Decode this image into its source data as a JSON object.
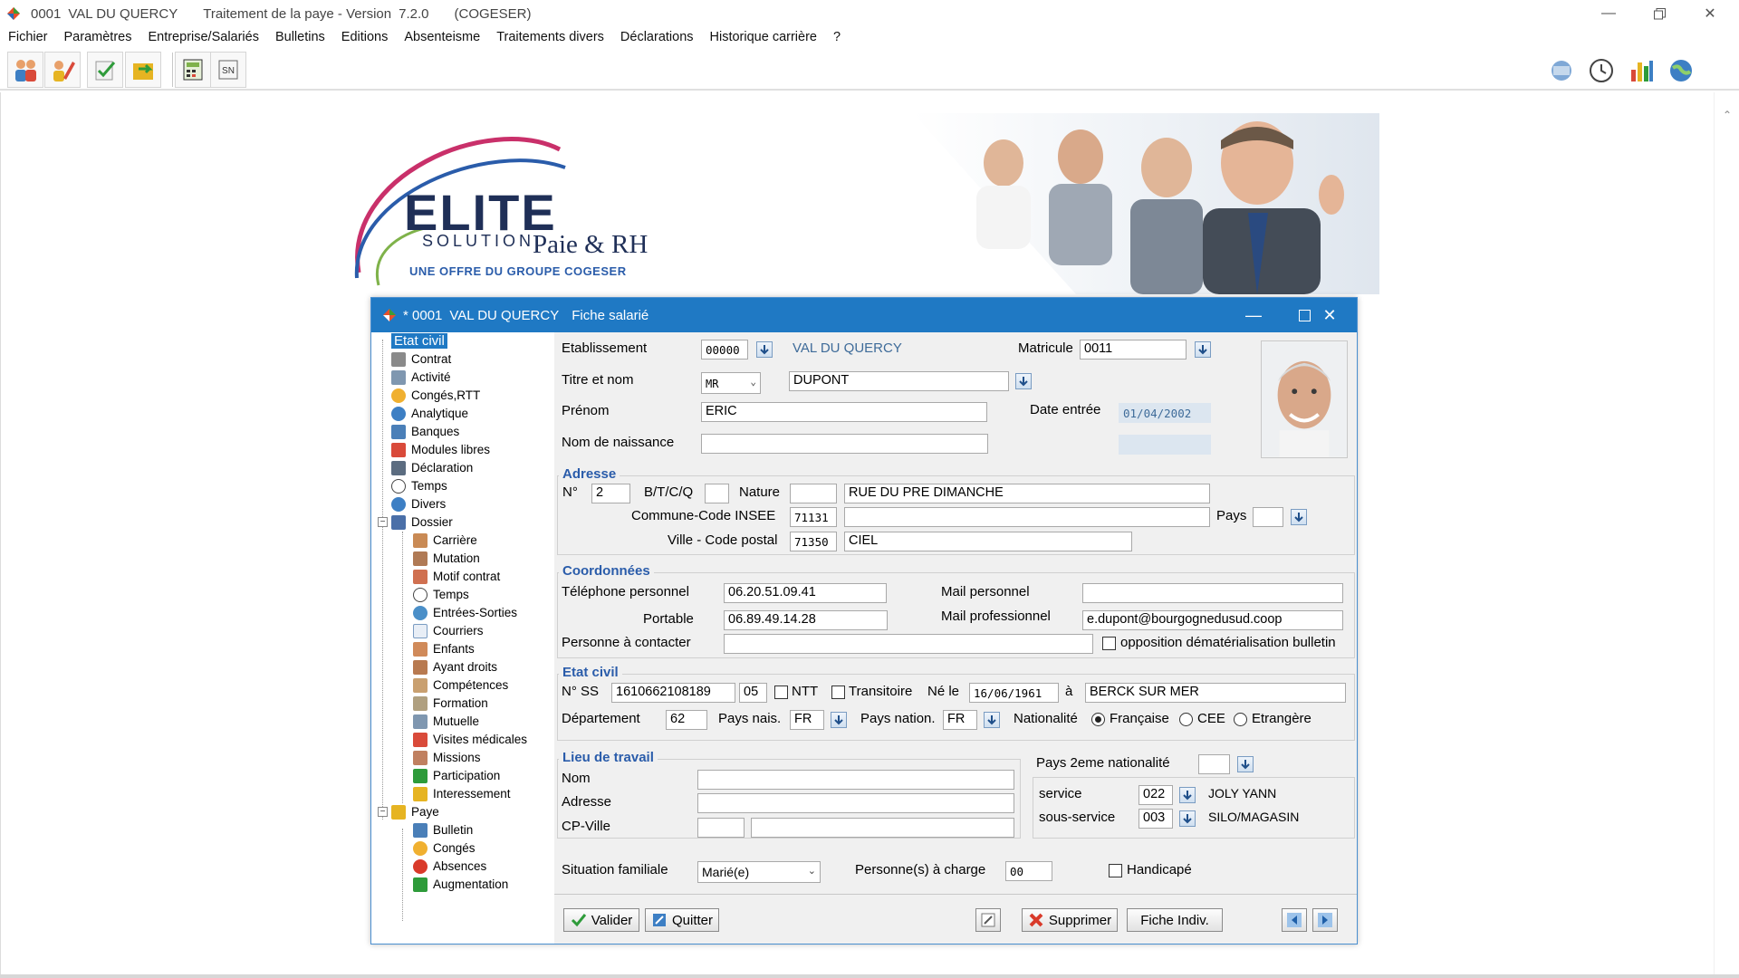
{
  "window": {
    "code": "0001",
    "company": "VAL DU QUERCY",
    "app": "Traitement de la paye - Version",
    "version": "7.2.0",
    "vendor": "(COGESER)"
  },
  "menu": [
    "Fichier",
    "Paramètres",
    "Entreprise/Salariés",
    "Bulletins",
    "Editions",
    "Absenteisme",
    "Traitements divers",
    "Déclarations",
    "Historique carrière",
    "?"
  ],
  "banner": {
    "elite": "ELITE",
    "solution": "SOLUTION",
    "paie": "Paie & RH",
    "offre": "UNE OFFRE DU GROUPE COGESER"
  },
  "dialog": {
    "code": "* 0001",
    "company": "VAL DU QUERCY",
    "title": "Fiche salarié"
  },
  "tree": {
    "top": [
      "Etat civil",
      "Contrat",
      "Activité",
      "Congés,RTT",
      "Analytique",
      "Banques",
      "Modules libres",
      "Déclaration",
      "Temps",
      "Divers"
    ],
    "dossier": "Dossier",
    "dossier_items": [
      "Carrière",
      "Mutation",
      "Motif contrat",
      "Temps",
      "Entrées-Sorties",
      "Courriers",
      "Enfants",
      "Ayant droits",
      "Compétences",
      "Formation",
      "Mutuelle",
      "Visites médicales",
      "Missions",
      "Participation",
      "Interessement"
    ],
    "paye": "Paye",
    "paye_items": [
      "Bulletin",
      "Congés",
      "Absences",
      "Augmentation"
    ]
  },
  "form": {
    "etablissement_label": "Etablissement",
    "etablissement_code": "00000",
    "etablissement_name": "VAL DU QUERCY",
    "matricule_label": "Matricule",
    "matricule": "0011",
    "titre_label": "Titre et nom",
    "titre": "MR",
    "nom": "DUPONT",
    "prenom_label": "Prénom",
    "prenom": "ERIC",
    "date_entree_label": "Date entrée",
    "date_entree": "01/04/2002",
    "nom_naissance_label": "Nom de naissance",
    "nom_naissance": "",
    "adresse": {
      "title": "Adresse",
      "num_label": "N°",
      "num": "2",
      "btcq_label": "B/T/C/Q",
      "btcq": "",
      "nature_label": "Nature",
      "nature": "",
      "rue": "RUE DU PRE DIMANCHE",
      "commune_label": "Commune-Code INSEE",
      "insee": "71131",
      "commune": "",
      "pays_label": "Pays",
      "pays": "",
      "ville_label": "Ville - Code postal",
      "cp": "71350",
      "ville": "CIEL"
    },
    "coord": {
      "title": "Coordonnées",
      "tel_label": "Téléphone personnel",
      "tel": "06.20.51.09.41",
      "portable_label": "Portable",
      "portable": "06.89.49.14.28",
      "contact_label": "Personne à contacter",
      "contact": "",
      "mail_perso_label": "Mail personnel",
      "mail_perso": "",
      "mail_pro_label": "Mail professionnel",
      "mail_pro": "e.dupont@bourgognedusud.coop",
      "opposition_label": "opposition dématérialisation bulletin"
    },
    "etat": {
      "title": "Etat civil",
      "ss_label": "N° SS",
      "ss": "1610662108189",
      "ss_key": "05",
      "ntt_label": "NTT",
      "transitoire_label": "Transitoire",
      "ne_le_label": "Né le",
      "ne_le": "16/06/1961",
      "a_label": "à",
      "lieu": "BERCK SUR MER",
      "dept_label": "Département",
      "dept": "62",
      "pays_nais_label": "Pays nais.",
      "pays_nais": "FR",
      "pays_nation_label": "Pays nation.",
      "pays_nation": "FR",
      "nationalite_label": "Nationalité",
      "nat_fr": "Française",
      "nat_cee": "CEE",
      "nat_etr": "Etrangère"
    },
    "lieu": {
      "title": "Lieu de travail",
      "nom_label": "Nom",
      "adresse_label": "Adresse",
      "cp_label": "CP-Ville",
      "pays2_label": "Pays 2eme nationalité",
      "pays2": "",
      "service_label": "service",
      "service_code": "022",
      "service_name": "JOLY YANN",
      "sous_label": "sous-service",
      "sous_code": "003",
      "sous_name": "SILO/MAGASIN"
    },
    "situation_label": "Situation familiale",
    "situation": "Marié(e)",
    "charge_label": "Personne(s) à charge",
    "charge": "00",
    "handicape_label": "Handicapé"
  },
  "buttons": {
    "valider": "Valider",
    "quitter": "Quitter",
    "supprimer": "Supprimer",
    "fiche": "Fiche Indiv."
  },
  "colors": {
    "accent": "#1f79c4",
    "group_title": "#2a5caa",
    "logo": "#1f2f57"
  }
}
